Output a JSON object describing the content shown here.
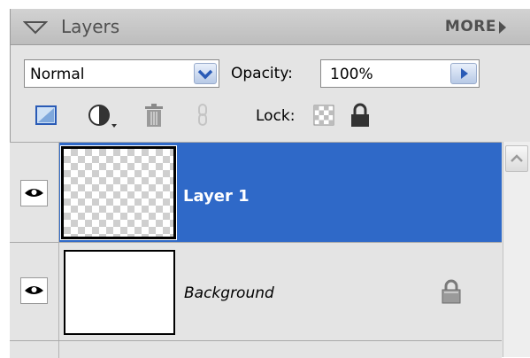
{
  "panel": {
    "title": "Layers",
    "more_label": "MORE",
    "icons": {
      "collapse": "collapse-triangle-icon",
      "more": "play-arrow-icon"
    }
  },
  "toolbar": {
    "blend_mode": "Normal",
    "opacity_label": "Opacity:",
    "opacity_value": "100%",
    "lock_label": "Lock:",
    "icons": [
      "new-layer-icon",
      "adjustment-layer-icon",
      "trash-icon",
      "link-icon",
      "lock-transparency-icon",
      "lock-all-icon"
    ]
  },
  "layers": [
    {
      "name": "Layer 1",
      "visible": true,
      "selected": true,
      "thumbnail": "transparent-checkerboard"
    },
    {
      "name": "Background",
      "visible": true,
      "selected": false,
      "locked": true,
      "thumbnail": "white"
    }
  ],
  "colors": {
    "selection": "#2f69c8",
    "panel_bg": "#e4e4e4",
    "title_bar": "#c8c8c8"
  }
}
